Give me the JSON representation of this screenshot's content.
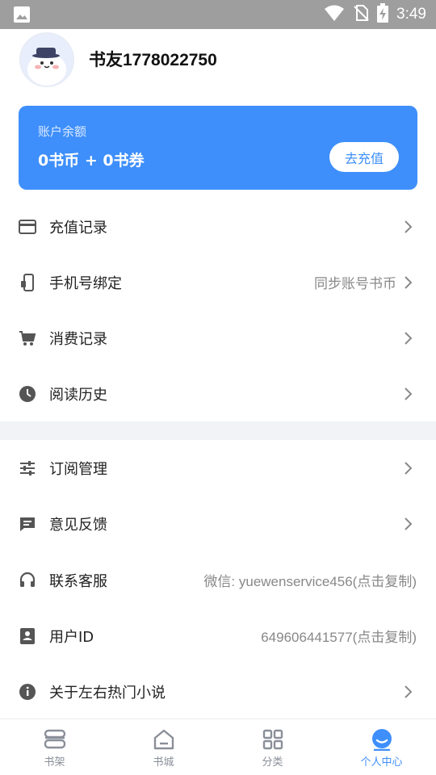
{
  "status_bar": {
    "time": "3:49"
  },
  "profile": {
    "nickname": "书友1778022750"
  },
  "balance": {
    "label": "账户余额",
    "amount": "0书币 + 0书券",
    "recharge_label": "去充值"
  },
  "menu_primary": [
    {
      "label": "充值记录",
      "icon": "card-icon",
      "extra": ""
    },
    {
      "label": "手机号绑定",
      "icon": "phone-icon",
      "extra": "同步账号书币"
    },
    {
      "label": "消费记录",
      "icon": "cart-icon",
      "extra": ""
    },
    {
      "label": "阅读历史",
      "icon": "clock-icon",
      "extra": ""
    }
  ],
  "menu_secondary": [
    {
      "label": "订阅管理",
      "icon": "sliders-icon",
      "extra": ""
    },
    {
      "label": "意见反馈",
      "icon": "feedback-icon",
      "extra": ""
    },
    {
      "label": "联系客服",
      "icon": "headset-icon",
      "extra": "微信: yuewenservice456(点击复制)"
    },
    {
      "label": "用户ID",
      "icon": "id-card-icon",
      "extra": "649606441577(点击复制)"
    },
    {
      "label": "关于左右热门小说",
      "icon": "info-icon",
      "extra": ""
    }
  ],
  "tabs": [
    {
      "label": "书架",
      "icon": "bookshelf-icon",
      "active": false
    },
    {
      "label": "书城",
      "icon": "store-icon",
      "active": false
    },
    {
      "label": "分类",
      "icon": "grid-icon",
      "active": false
    },
    {
      "label": "个人中心",
      "icon": "person-icon",
      "active": true
    }
  ],
  "colors": {
    "accent": "#3e8ffb",
    "status_bar": "#9e9e9e",
    "divider": "#f1f3f6",
    "muted": "#888888"
  }
}
